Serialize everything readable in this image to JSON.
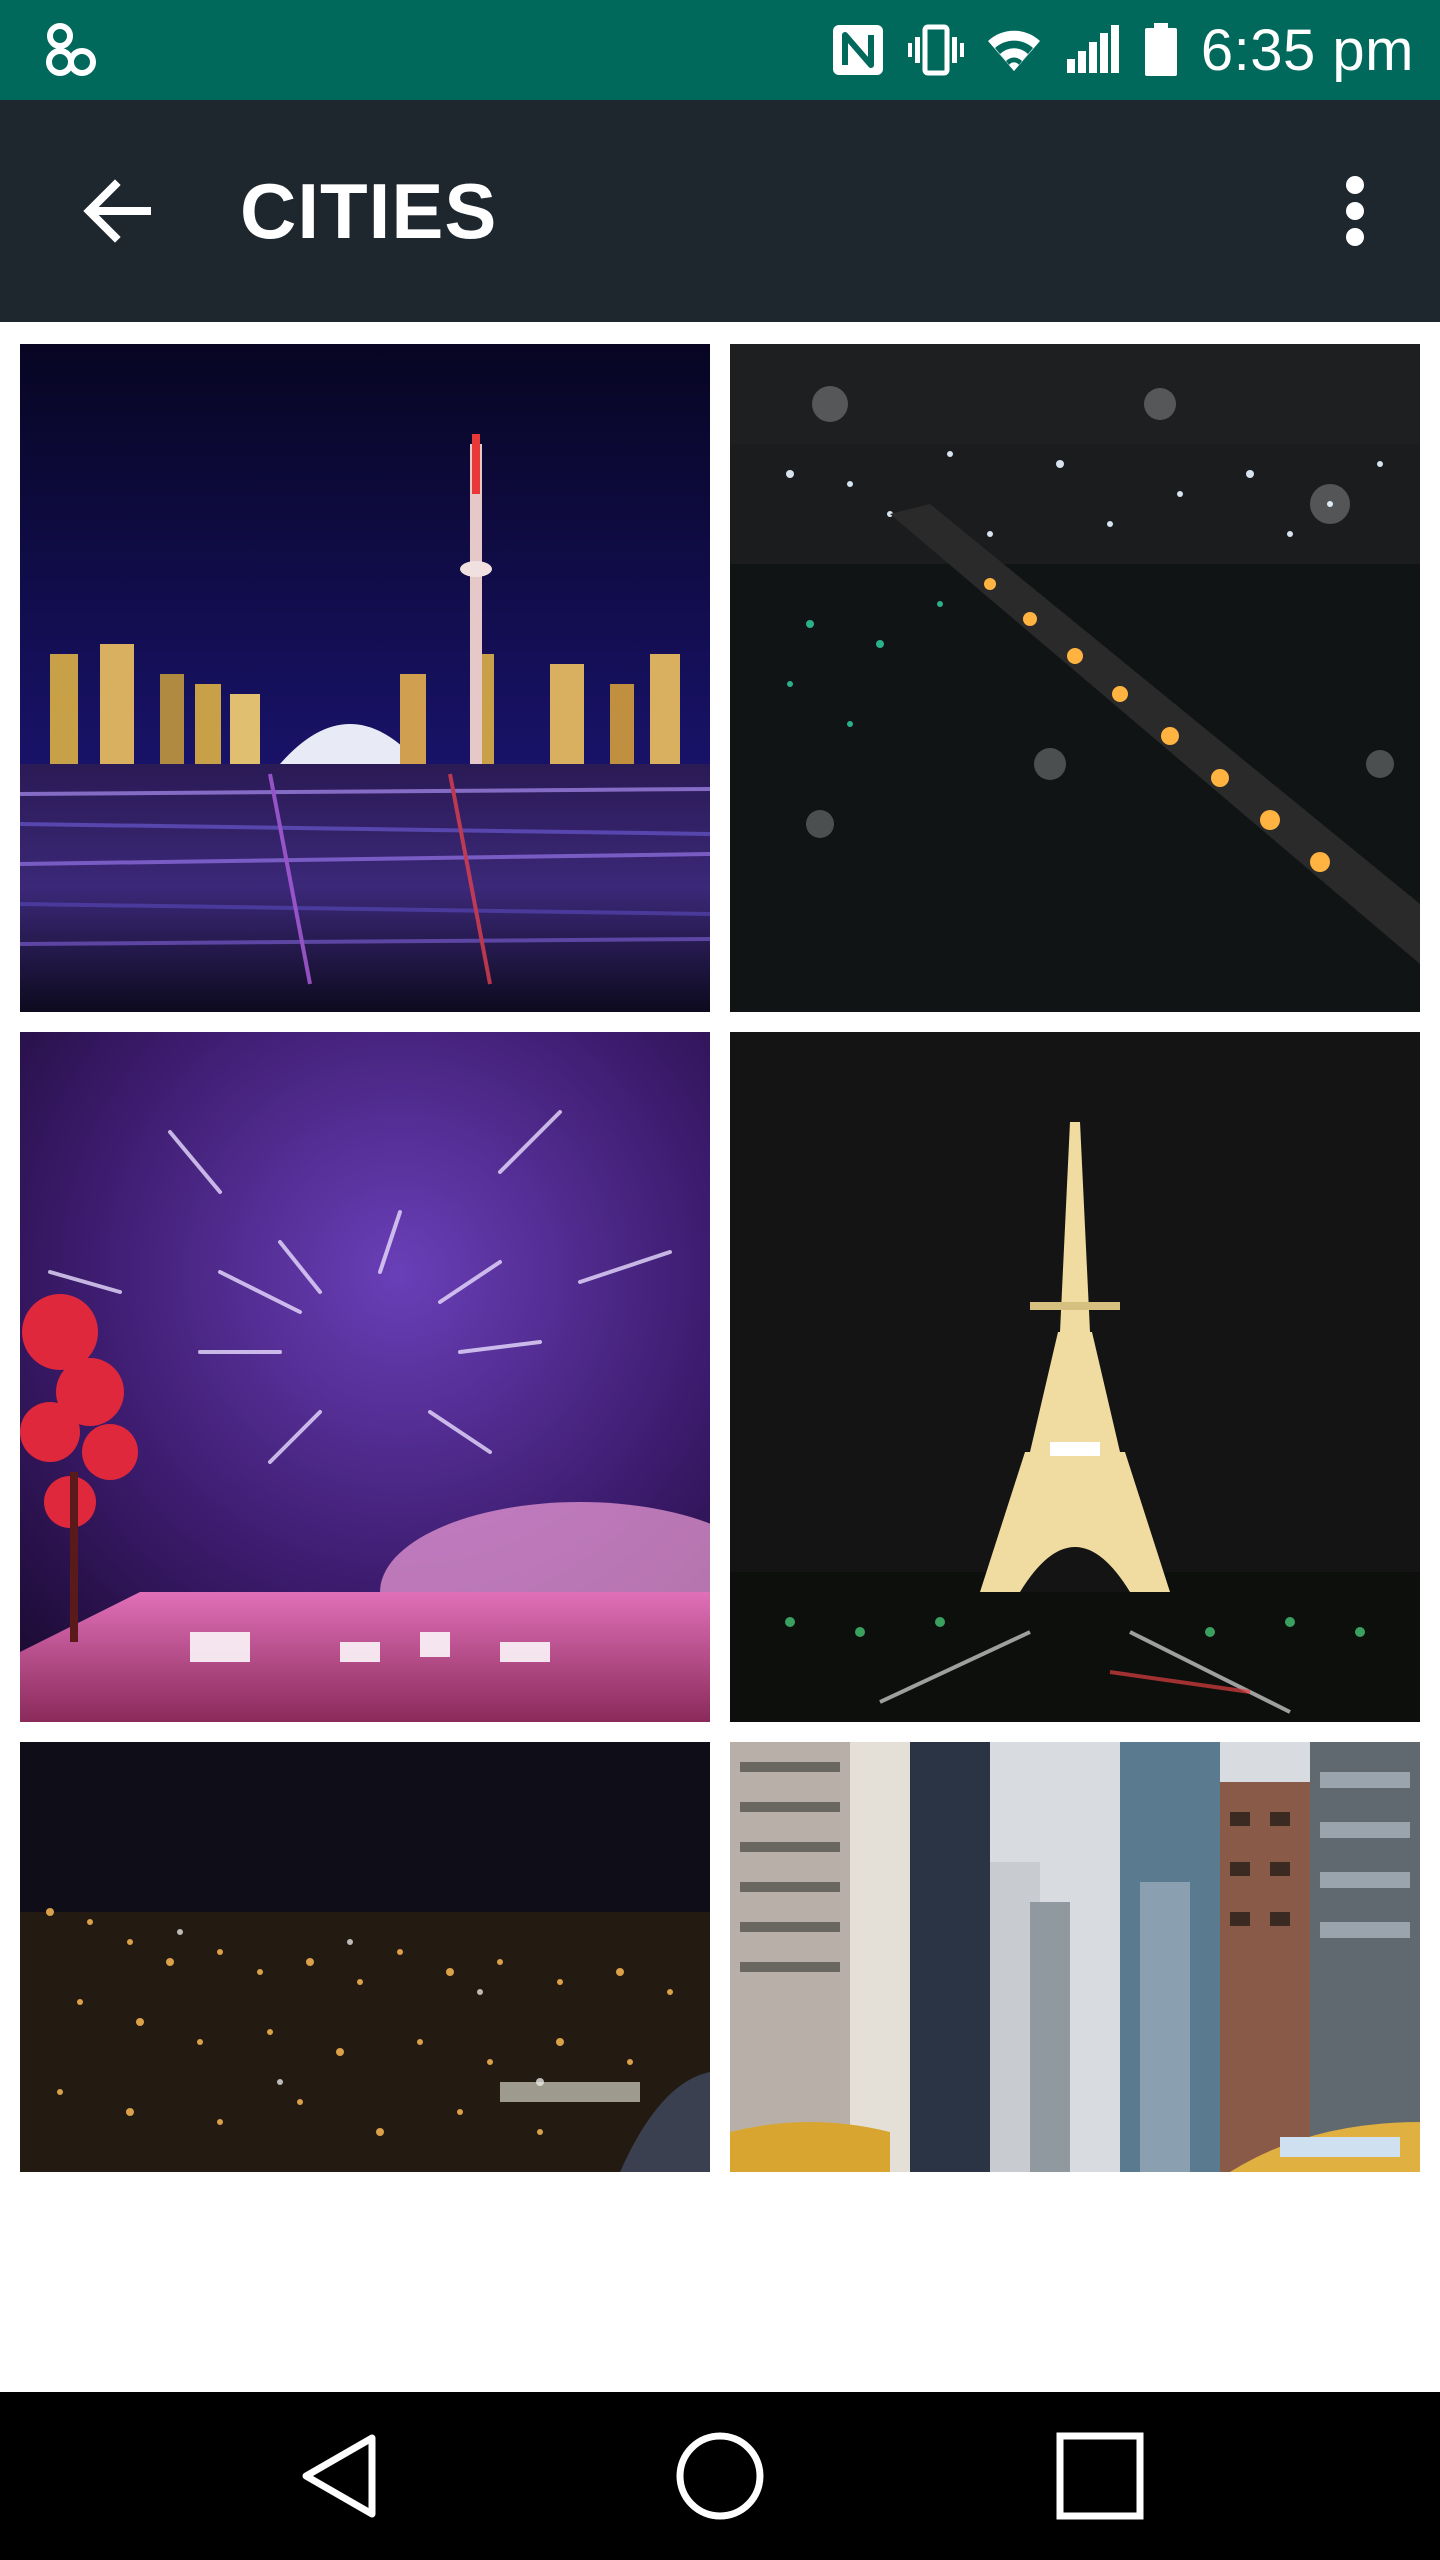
{
  "status_bar": {
    "time": "6:35 pm",
    "left_icon": "app-notification-icon",
    "icons": [
      "nfc-icon",
      "vibrate-icon",
      "wifi-icon",
      "cell-signal-icon",
      "battery-icon"
    ],
    "background": "#00695c"
  },
  "app_bar": {
    "title": "CITIES",
    "back_icon": "arrow-back-icon",
    "menu_icon": "more-vert-icon",
    "background": "#1f272e"
  },
  "gallery": {
    "items": [
      {
        "subject": "toronto-skyline-night"
      },
      {
        "subject": "bridge-over-river-night"
      },
      {
        "subject": "fireworks-star-trails"
      },
      {
        "subject": "eiffel-tower-night"
      },
      {
        "subject": "city-lights-aerial"
      },
      {
        "subject": "new-york-street-taxis"
      }
    ]
  },
  "nav_bar": {
    "buttons": [
      "back-triangle-icon",
      "home-circle-icon",
      "recents-square-icon"
    ],
    "background": "#000000"
  }
}
